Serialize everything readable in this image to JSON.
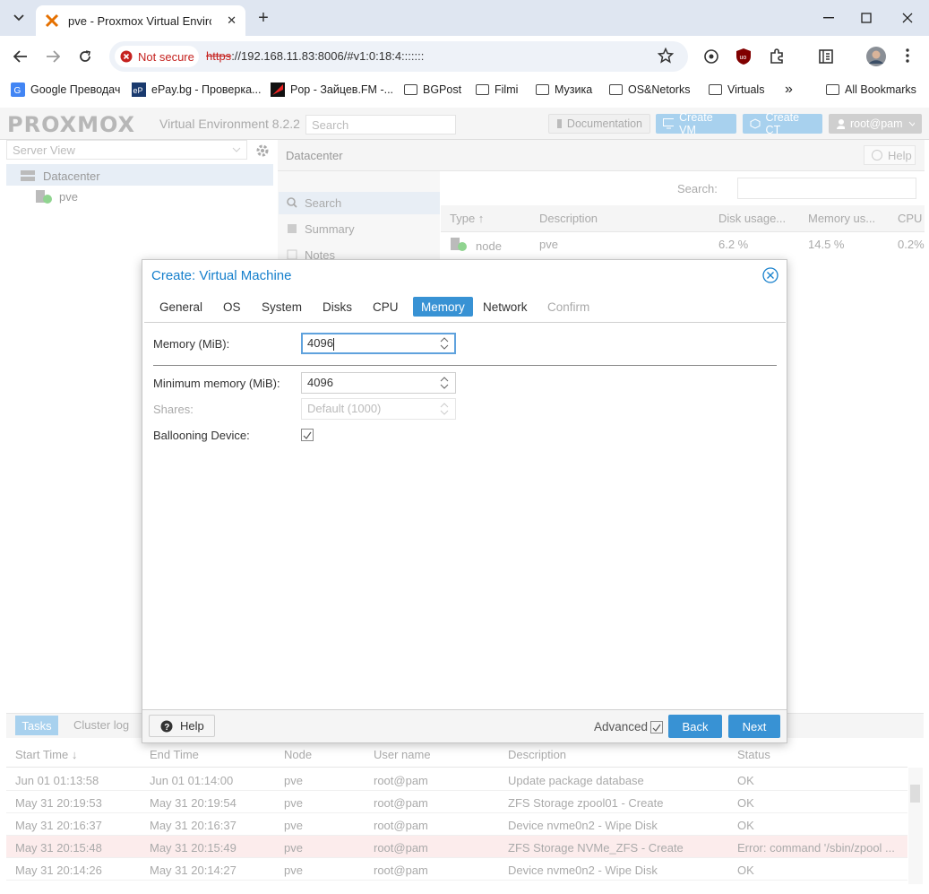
{
  "browser": {
    "tab_title": "pve - Proxmox Virtual Environm",
    "tab_close": "✕",
    "new_tab": "+",
    "security_label": "Not secure",
    "url_scheme": "https",
    "url_rest": "://192.168.11.83:8006/#v1:0:18:4:::::::",
    "bookmarks": [
      "Google Преводач",
      "ePay.bg - Проверка...",
      "Pop - Зайцев.FM -...",
      "BGPost",
      "Filmi",
      "Музика",
      "OS&Netorks",
      "Virtuals"
    ],
    "more_bookmarks": "»",
    "all_bookmarks": "All Bookmarks"
  },
  "pve": {
    "logo": "PROXMOX",
    "version_title": "Virtual Environment 8.2.2",
    "search_placeholder": "Search",
    "documentation": "Documentation",
    "create_vm": "Create VM",
    "create_ct": "Create CT",
    "user": "root@pam",
    "server_view": "Server View",
    "tree": [
      "Datacenter",
      "pve"
    ],
    "content_title": "Datacenter",
    "help": "Help",
    "menu": [
      "Search",
      "Summary",
      "Notes"
    ],
    "search_label": "Search:",
    "grid_headers": [
      "Type ↑",
      "Description",
      "Disk usage...",
      "Memory us...",
      "CPU"
    ],
    "grid_row": [
      "node",
      "pve",
      "6.2 %",
      "14.5 %",
      "0.2%"
    ]
  },
  "tasks": {
    "tabs": [
      "Tasks",
      "Cluster log"
    ],
    "headers": [
      "Start Time ↓",
      "End Time",
      "Node",
      "User name",
      "Description",
      "Status"
    ],
    "rows": [
      [
        "Jun 01 01:13:58",
        "Jun 01 01:14:00",
        "pve",
        "root@pam",
        "Update package database",
        "OK"
      ],
      [
        "May 31 20:19:53",
        "May 31 20:19:54",
        "pve",
        "root@pam",
        "ZFS Storage zpool01 - Create",
        "OK"
      ],
      [
        "May 31 20:16:37",
        "May 31 20:16:37",
        "pve",
        "root@pam",
        "Device nvme0n2 - Wipe Disk",
        "OK"
      ],
      [
        "May 31 20:15:48",
        "May 31 20:15:49",
        "pve",
        "root@pam",
        "ZFS Storage NVMe_ZFS - Create",
        "Error: command '/sbin/zpool ..."
      ],
      [
        "May 31 20:14:26",
        "May 31 20:14:27",
        "pve",
        "root@pam",
        "Device nvme0n2 - Wipe Disk",
        "OK"
      ]
    ]
  },
  "dialog": {
    "title": "Create: Virtual Machine",
    "tabs": [
      "General",
      "OS",
      "System",
      "Disks",
      "CPU",
      "Memory",
      "Network",
      "Confirm"
    ],
    "active_tab": "Memory",
    "memory_label": "Memory (MiB):",
    "memory_value": "4096",
    "min_memory_label": "Minimum memory (MiB):",
    "min_memory_value": "4096",
    "shares_label": "Shares:",
    "shares_placeholder": "Default (1000)",
    "ballooning_label": "Ballooning Device:",
    "ballooning_checked": true,
    "help": "Help",
    "advanced": "Advanced",
    "advanced_checked": true,
    "back": "Back",
    "next": "Next"
  },
  "colors": {
    "accent": "#3892d4",
    "title_blue": "#157fcc",
    "error_row": "#fcecec"
  }
}
